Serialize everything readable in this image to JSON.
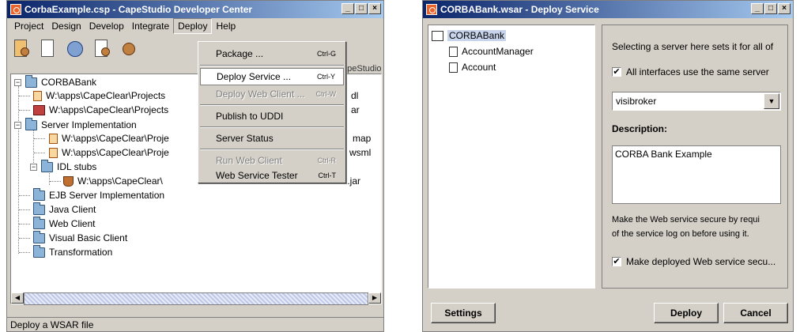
{
  "left_window": {
    "title": "CorbaExample.csp - CapeStudio Developer Center",
    "menu": [
      "Project",
      "Design",
      "Develop",
      "Integrate",
      "Deploy",
      "Help"
    ],
    "logo_text": "apeStudio",
    "tree": {
      "root": "CORBABank",
      "file1": "W:\\apps\\CapeClear\\Projects",
      "file1_tail": "dl",
      "file2": "W:\\apps\\CapeClear\\Projects",
      "file2_tail": "ar",
      "server_impl": "Server Implementation",
      "si_file1": "W:\\apps\\CapeClear\\Proje",
      "si_file1_tail": "map",
      "si_file2": "W:\\apps\\CapeClear\\Proje",
      "si_file2_tail": "wsml",
      "idl_stubs": "IDL stubs",
      "idl_file": "W:\\apps\\CapeClear\\",
      "idl_file_tail": "ank.jar",
      "ejb": "EJB Server Implementation",
      "java_client": "Java Client",
      "web_client": "Web Client",
      "vb_client": "Visual Basic Client",
      "transformation": "Transformation"
    },
    "dropdown": {
      "items": [
        {
          "label": "Package ...",
          "shortcut": "Ctrl-G"
        },
        {
          "label": "Deploy Service ...",
          "shortcut": "Ctrl-Y"
        },
        {
          "label": "Deploy Web Client ...",
          "shortcut": "Ctrl-W"
        },
        {
          "label": "Publish to UDDI",
          "shortcut": ""
        },
        {
          "label": "Server Status",
          "shortcut": ""
        },
        {
          "label": "Run Web Client",
          "shortcut": "Ctrl-R"
        },
        {
          "label": "Web Service Tester",
          "shortcut": "Ctrl-T"
        }
      ]
    },
    "status": "Deploy a WSAR file"
  },
  "right_window": {
    "title": "CORBABank.wsar - Deploy Service",
    "tree": {
      "root": "CORBABank",
      "child1": "AccountManager",
      "child2": "Account"
    },
    "server_hint": "Selecting a server here sets it for all of",
    "all_interfaces_label": "All interfaces use the same server",
    "server_value": "visibroker",
    "description_label": "Description:",
    "description_value": "CORBA Bank Example",
    "secure_hint_1": "Make the Web service secure by requi",
    "secure_hint_2": "of the service log on before using it.",
    "secure_checkbox_label": "Make deployed Web service secu...",
    "settings_button": "Settings",
    "deploy_button": "Deploy",
    "cancel_button": "Cancel"
  }
}
